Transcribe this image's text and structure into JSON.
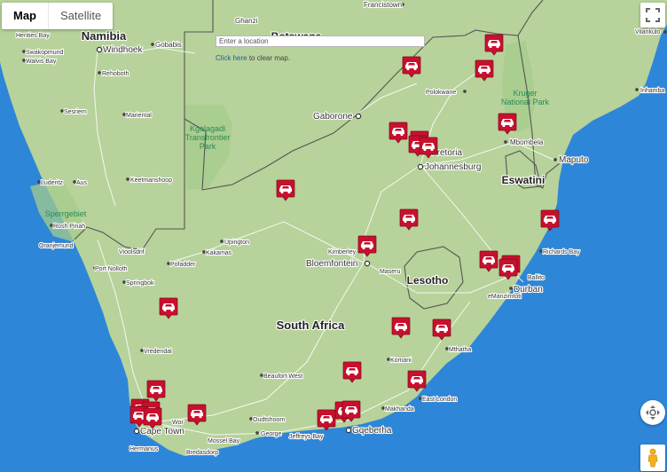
{
  "map_type_control": {
    "map_label": "Map",
    "satellite_label": "Satellite",
    "selected": "Map"
  },
  "search": {
    "placeholder": "Enter a location",
    "value": ""
  },
  "clear_note": {
    "link_text": "Click here",
    "suffix_text": "to clear map."
  },
  "controls": {
    "fullscreen_icon": "fullscreen-icon",
    "move_icon": "move-camera-icon",
    "street_view_icon": "pegman-icon"
  },
  "colors": {
    "water": "#2e86d8",
    "land": "#b7d29a",
    "park": "#a5cc8c",
    "marker": "#c8102e",
    "road": "#ffffff",
    "border": "#555555"
  },
  "labels": {
    "countries": {
      "namibia": "Namibia",
      "south_africa": "South Africa",
      "lesotho": "Lesotho",
      "eswatini": "Eswatini",
      "botswana_partial": "Botswana"
    },
    "parks": {
      "kruger_1": "Kruger",
      "kruger_2": "National Park",
      "kgalagadi_1": "Kgalagadi",
      "kgalagadi_2": "Transfrontier",
      "kgalagadi_3": "Park",
      "sperrgebiet": "Sperrgebiet"
    },
    "cities": {
      "francistown": "Francistown",
      "ghanzi": "Ghanzi",
      "vilankulo": "Vilankulo",
      "henties_bay": "Henties Bay",
      "windhoek": "Windhoek",
      "gobabis": "Gobabis",
      "swakopmund": "Swakopmund",
      "walvis_bay": "Walvis Bay",
      "rehoboth": "Rehoboth",
      "polokwane": "Polokwane",
      "inhambane": "Inhamba",
      "sesriem": "Sesriem",
      "mariental": "Mariental",
      "gaborone": "Gaborone",
      "mbombela": "Mbombela",
      "pretoria": "Pretoria",
      "maputo": "Maputo",
      "johannesburg": "Johannesburg",
      "luderitz": "Luderitz",
      "aus": "Aus",
      "keetmanshoop": "Keetmanshoop",
      "rosh_pinah": "Rosh Pinah",
      "oranjemund": "Oranjemund",
      "upington": "Upington",
      "kakamas": "Kakamas",
      "vioolsdrif": "Vioolsdrif",
      "kimberley": "Kimberley",
      "bloemfontein": "Bloemfontein",
      "richards_bay": "Richards Bay",
      "port_nolloth": "Port Nolloth",
      "pofadder": "Pofadder",
      "maseru": "Maseru",
      "ballito": "Ballito",
      "springbok": "Springbok",
      "emanzimtoti": "eManzimtoti",
      "durban": "Durban",
      "mthatha": "Mthatha",
      "vredendal": "Vredendal",
      "komani": "Komani",
      "beaufort_west": "Beaufort West",
      "east_london": "East London",
      "makhanda": "Makhanda",
      "oudtshoorn": "Oudtshoorn",
      "worcester": "Wor",
      "cape_town": "Cape Town",
      "george": "George",
      "jeffreys_bay": "Jeffreys Bay",
      "gqeberha": "Gqeberha",
      "mossel_bay": "Mossel Bay",
      "hermanus": "Hermanus",
      "bredasdorp": "Bredasdorp"
    }
  },
  "markers": {
    "count": 36,
    "icon": "car-marker-icon"
  }
}
